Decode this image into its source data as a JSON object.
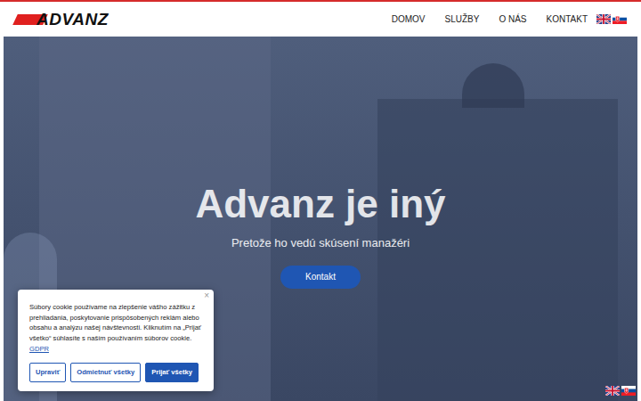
{
  "header": {
    "logo": "ADVANZ",
    "nav": [
      {
        "label": "DOMOV"
      },
      {
        "label": "SLUŽBY"
      },
      {
        "label": "O NÁS"
      },
      {
        "label": "KONTAKT"
      }
    ]
  },
  "hero": {
    "title": "Advanz je iný",
    "subtitle": "Pretože ho vedú skúsení manažéri",
    "button": "Kontakt"
  },
  "cookie_banner": {
    "text": "Súbory cookie používame na zlepšenie vášho zážitku z prehliadania, poskytovanie prispôsobených reklám alebo obsahu a analýzu našej návštevnosti. Kliknutím na „Prijať všetko“ súhlasíte s naším používaním súborov cookie.",
    "link": "GDPR",
    "close": "×",
    "buttons": [
      {
        "label": "Upraviť",
        "kind": "outline"
      },
      {
        "label": "Odmietnuť všetky",
        "kind": "outline"
      },
      {
        "label": "Prijať všetky",
        "kind": "primary"
      }
    ]
  }
}
